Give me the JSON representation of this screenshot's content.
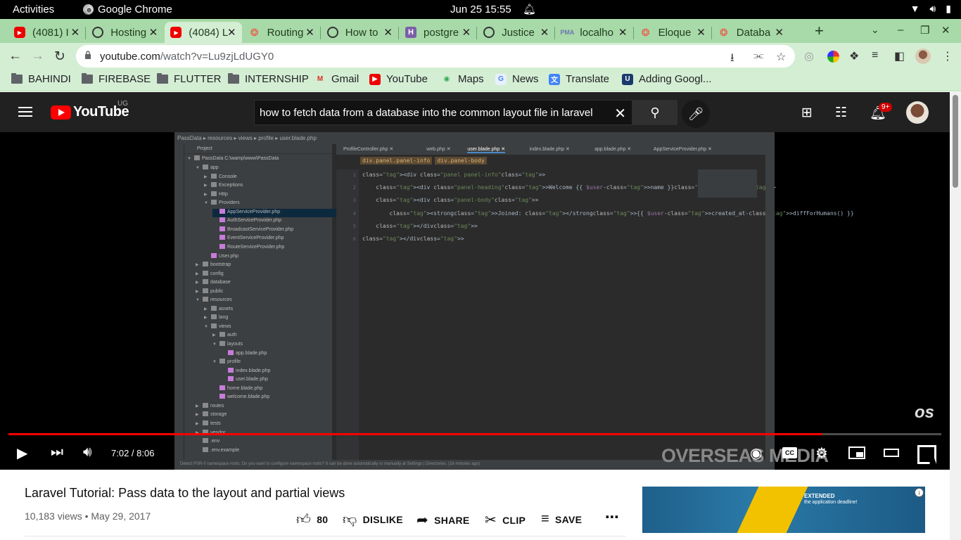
{
  "system_bar": {
    "activities": "Activities",
    "app_name": "Google Chrome",
    "clock": "Jun 25  15:55"
  },
  "tabs": [
    {
      "title": "(4081) I",
      "favicon": "youtube-icon",
      "active": false
    },
    {
      "title": "Hosting",
      "favicon": "globe-icon",
      "active": false
    },
    {
      "title": "(4084) L",
      "favicon": "youtube-icon",
      "active": true
    },
    {
      "title": "Routing",
      "favicon": "laravel-icon",
      "active": false
    },
    {
      "title": "How to",
      "favicon": "globe-icon",
      "active": false
    },
    {
      "title": "postgre",
      "favicon": "heroku-icon",
      "active": false
    },
    {
      "title": "Justice",
      "favicon": "globe-icon",
      "active": false
    },
    {
      "title": "localho",
      "favicon": "phpmyadmin-icon",
      "active": false
    },
    {
      "title": "Eloque",
      "favicon": "laravel-icon",
      "active": false
    },
    {
      "title": "Databa",
      "favicon": "laravel-icon",
      "active": false
    }
  ],
  "toolbar": {
    "url_host": "youtube.com",
    "url_path": "/watch?v=Lu9zjLdUGY0"
  },
  "bookmarks": [
    {
      "label": "BAHINDI",
      "icon": "folder-icon"
    },
    {
      "label": "FIREBASE",
      "icon": "folder-icon"
    },
    {
      "label": "FLUTTER",
      "icon": "folder-icon"
    },
    {
      "label": "INTERNSHIP",
      "icon": "folder-icon"
    },
    {
      "label": "Gmail",
      "icon": "gmail-icon"
    },
    {
      "label": "YouTube",
      "icon": "youtube-icon"
    },
    {
      "label": "Maps",
      "icon": "maps-icon"
    },
    {
      "label": "News",
      "icon": "news-icon"
    },
    {
      "label": "Translate",
      "icon": "translate-icon"
    },
    {
      "label": "Adding Googl...",
      "icon": "ucsc-icon"
    }
  ],
  "youtube": {
    "logo_text": "YouTube",
    "country": "UG",
    "search_query": "how to fetch data from a database into the common layout file in laravel",
    "notification_count": "9+"
  },
  "player": {
    "current_time": "7:02",
    "duration": "8:06",
    "time_display": "7:02 / 8:06",
    "progress_fraction": 0.8724,
    "watermark": "os",
    "brand": "OVERSEAS MEDIA"
  },
  "ide": {
    "path": [
      "PassData",
      "resources",
      "views",
      "profile",
      "user.blade.php"
    ],
    "project_label": "Project",
    "root_label": "PassData  C:\\wamp\\www\\PassData",
    "tree": [
      {
        "label": "app",
        "depth": 1,
        "open": true,
        "dir": true
      },
      {
        "label": "Console",
        "depth": 2,
        "open": false,
        "dir": true
      },
      {
        "label": "Exceptions",
        "depth": 2,
        "open": false,
        "dir": true
      },
      {
        "label": "Http",
        "depth": 2,
        "open": false,
        "dir": true
      },
      {
        "label": "Providers",
        "depth": 2,
        "open": true,
        "dir": true
      },
      {
        "label": "AppServiceProvider.php",
        "depth": 3,
        "selected": true
      },
      {
        "label": "AuthServiceProvider.php",
        "depth": 3
      },
      {
        "label": "BroadcastServiceProvider.php",
        "depth": 3
      },
      {
        "label": "EventServiceProvider.php",
        "depth": 3
      },
      {
        "label": "RouteServiceProvider.php",
        "depth": 3
      },
      {
        "label": "User.php",
        "depth": 2
      },
      {
        "label": "bootstrap",
        "depth": 1,
        "dir": true
      },
      {
        "label": "config",
        "depth": 1,
        "dir": true
      },
      {
        "label": "database",
        "depth": 1,
        "dir": true
      },
      {
        "label": "public",
        "depth": 1,
        "dir": true
      },
      {
        "label": "resources",
        "depth": 1,
        "open": true,
        "dir": true
      },
      {
        "label": "assets",
        "depth": 2,
        "dir": true
      },
      {
        "label": "lang",
        "depth": 2,
        "dir": true
      },
      {
        "label": "views",
        "depth": 2,
        "open": true,
        "dir": true
      },
      {
        "label": "auth",
        "depth": 3,
        "dir": true
      },
      {
        "label": "layouts",
        "depth": 3,
        "open": true,
        "dir": true
      },
      {
        "label": "app.blade.php",
        "depth": 4,
        "blade": true
      },
      {
        "label": "profile",
        "depth": 3,
        "open": true,
        "dir": true
      },
      {
        "label": "index.blade.php",
        "depth": 4,
        "blade": true
      },
      {
        "label": "user.blade.php",
        "depth": 4,
        "blade": true
      },
      {
        "label": "home.blade.php",
        "depth": 3,
        "blade": true
      },
      {
        "label": "welcome.blade.php",
        "depth": 3,
        "blade": true
      },
      {
        "label": "routes",
        "depth": 1,
        "dir": true
      },
      {
        "label": "storage",
        "depth": 1,
        "dir": true
      },
      {
        "label": "tests",
        "depth": 1,
        "dir": true
      },
      {
        "label": "vendor",
        "depth": 1,
        "dir": true
      },
      {
        "label": ".env",
        "depth": 1
      },
      {
        "label": ".env.example",
        "depth": 1
      }
    ],
    "editor_tabs": [
      "ProfileController.php",
      "web.php",
      "user.blade.php",
      "index.blade.php",
      "app.blade.php",
      "AppServiceProvider.php"
    ],
    "active_editor_tab": "user.blade.php",
    "crumbs": [
      "div.panel.panel-info",
      "div.panel-body"
    ],
    "code": [
      "<div class=\"panel panel-info\">",
      "    <div class=\"panel-heading\">Welcome {{ $user->name }}</div>",
      "    <div class=\"panel-body\">",
      "        <strong>Joined: </strong>{{ $user->created_at->diffForHumans() }}",
      "    </div>",
      "</div>"
    ],
    "status": "Detect PSR-0 namespace roots: Do you want to configure namespace roots? It can be done automatically or manually at Settings | Directories. (16 minutes ago)"
  },
  "video": {
    "title": "Laravel Tutorial: Pass data to the layout and partial views",
    "meta": "10,183 views • May 29, 2017",
    "likes": "80",
    "dislike_label": "DISLIKE",
    "share_label": "SHARE",
    "clip_label": "CLIP",
    "save_label": "SAVE"
  },
  "ad": {
    "line1": "EXTENDED",
    "line2": "the application deadline!"
  }
}
